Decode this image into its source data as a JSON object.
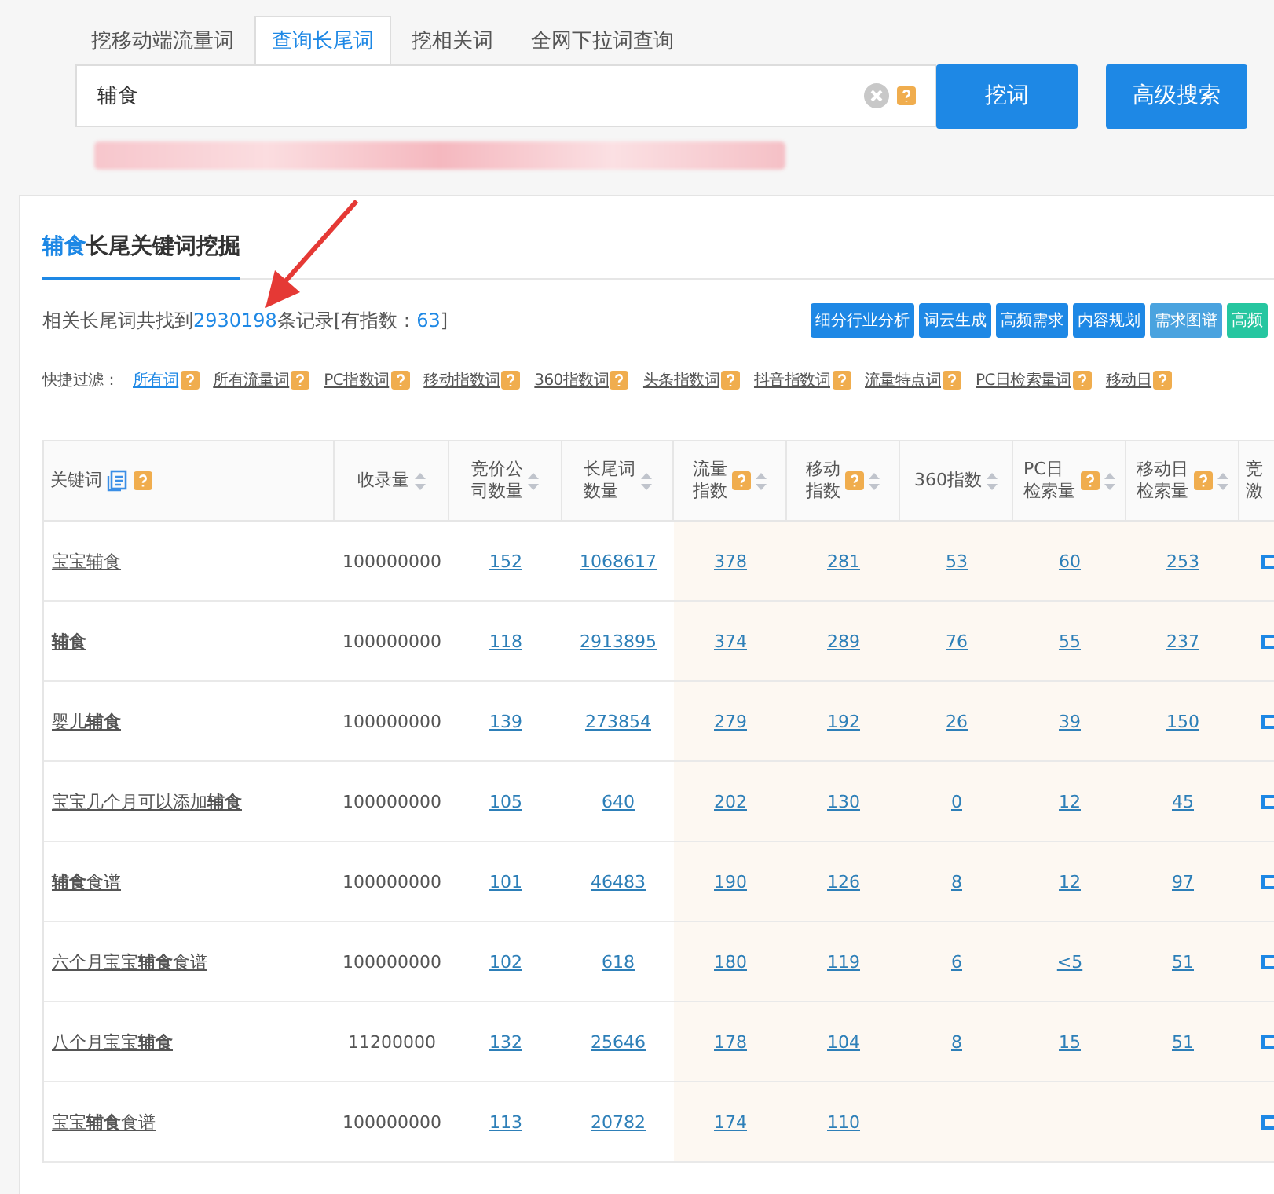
{
  "tabs": [
    {
      "label": "挖移动端流量词",
      "selected": false
    },
    {
      "label": "查询长尾词",
      "selected": true
    },
    {
      "label": "挖相关词",
      "selected": false
    },
    {
      "label": "全网下拉词查询",
      "selected": false
    }
  ],
  "search": {
    "value": "辅食",
    "submit": "挖词",
    "advanced": "高级搜索"
  },
  "section": {
    "keyword": "辅食",
    "title": "长尾关键词挖掘"
  },
  "summary": {
    "prefix": "相关长尾词共找到",
    "count": "2930198",
    "suffix": "条记录[有指数：",
    "index_count": "63",
    "close": "]"
  },
  "actions": [
    {
      "label": "细分行业分析",
      "color": "#1e88e5"
    },
    {
      "label": "词云生成",
      "color": "#1e88e5"
    },
    {
      "label": "高频需求",
      "color": "#1e88e5"
    },
    {
      "label": "内容规划",
      "color": "#1e88e5"
    },
    {
      "label": "需求图谱",
      "color": "#4aa3df"
    },
    {
      "label": "高频",
      "color": "#26c6a0"
    }
  ],
  "filters": {
    "label": "快捷过滤：",
    "items": [
      {
        "label": "所有词",
        "selected": true
      },
      {
        "label": "所有流量词",
        "selected": false
      },
      {
        "label": "PC指数词",
        "selected": false
      },
      {
        "label": "移动指数词",
        "selected": false
      },
      {
        "label": "360指数词",
        "selected": false
      },
      {
        "label": "头条指数词",
        "selected": false
      },
      {
        "label": "抖音指数词",
        "selected": false
      },
      {
        "label": "流量特点词",
        "selected": false
      },
      {
        "label": "PC日检索量词",
        "selected": false
      },
      {
        "label": "移动日",
        "selected": false
      }
    ]
  },
  "table": {
    "columns": [
      {
        "lines": [
          "关键词"
        ],
        "kind": "keyword"
      },
      {
        "lines": [
          "收录量"
        ],
        "kind": "sort"
      },
      {
        "lines": [
          "竞价公",
          "司数量"
        ],
        "kind": "sort"
      },
      {
        "lines": [
          "长尾词",
          "数量"
        ],
        "kind": "sort"
      },
      {
        "lines": [
          "流量",
          "指数"
        ],
        "kind": "help"
      },
      {
        "lines": [
          "移动",
          "指数"
        ],
        "kind": "help"
      },
      {
        "lines": [
          "360指数"
        ],
        "kind": "sort"
      },
      {
        "lines": [
          "PC日",
          "检索量"
        ],
        "kind": "help"
      },
      {
        "lines": [
          "移动日",
          "检索量"
        ],
        "kind": "help"
      },
      {
        "lines": [
          "竞",
          "激"
        ],
        "kind": "cut"
      }
    ],
    "rows": [
      {
        "cells": [
          "宝宝辅食",
          "100000000",
          "152",
          "1068617",
          "378",
          "281",
          "53",
          "60",
          "253"
        ]
      },
      {
        "cells": [
          "**辅食**",
          "100000000",
          "118",
          "2913895",
          "374",
          "289",
          "76",
          "55",
          "237"
        ]
      },
      {
        "cells": [
          "婴儿**辅食**",
          "100000000",
          "139",
          "273854",
          "279",
          "192",
          "26",
          "39",
          "150"
        ]
      },
      {
        "cells": [
          "宝宝几个月可以添加**辅食**",
          "100000000",
          "105",
          "640",
          "202",
          "130",
          "0",
          "12",
          "45"
        ]
      },
      {
        "cells": [
          "**辅食**食谱",
          "100000000",
          "101",
          "46483",
          "190",
          "126",
          "8",
          "12",
          "97"
        ]
      },
      {
        "cells": [
          "六个月宝宝**辅食**食谱",
          "100000000",
          "102",
          "618",
          "180",
          "119",
          "6",
          "<5",
          "51"
        ]
      },
      {
        "cells": [
          "八个月宝宝**辅食**",
          "11200000",
          "132",
          "25646",
          "178",
          "104",
          "8",
          "15",
          "51"
        ]
      },
      {
        "cells": [
          "宝宝**辅食**食谱",
          "100000000",
          "113",
          "20782",
          "174",
          "110"
        ]
      }
    ]
  }
}
